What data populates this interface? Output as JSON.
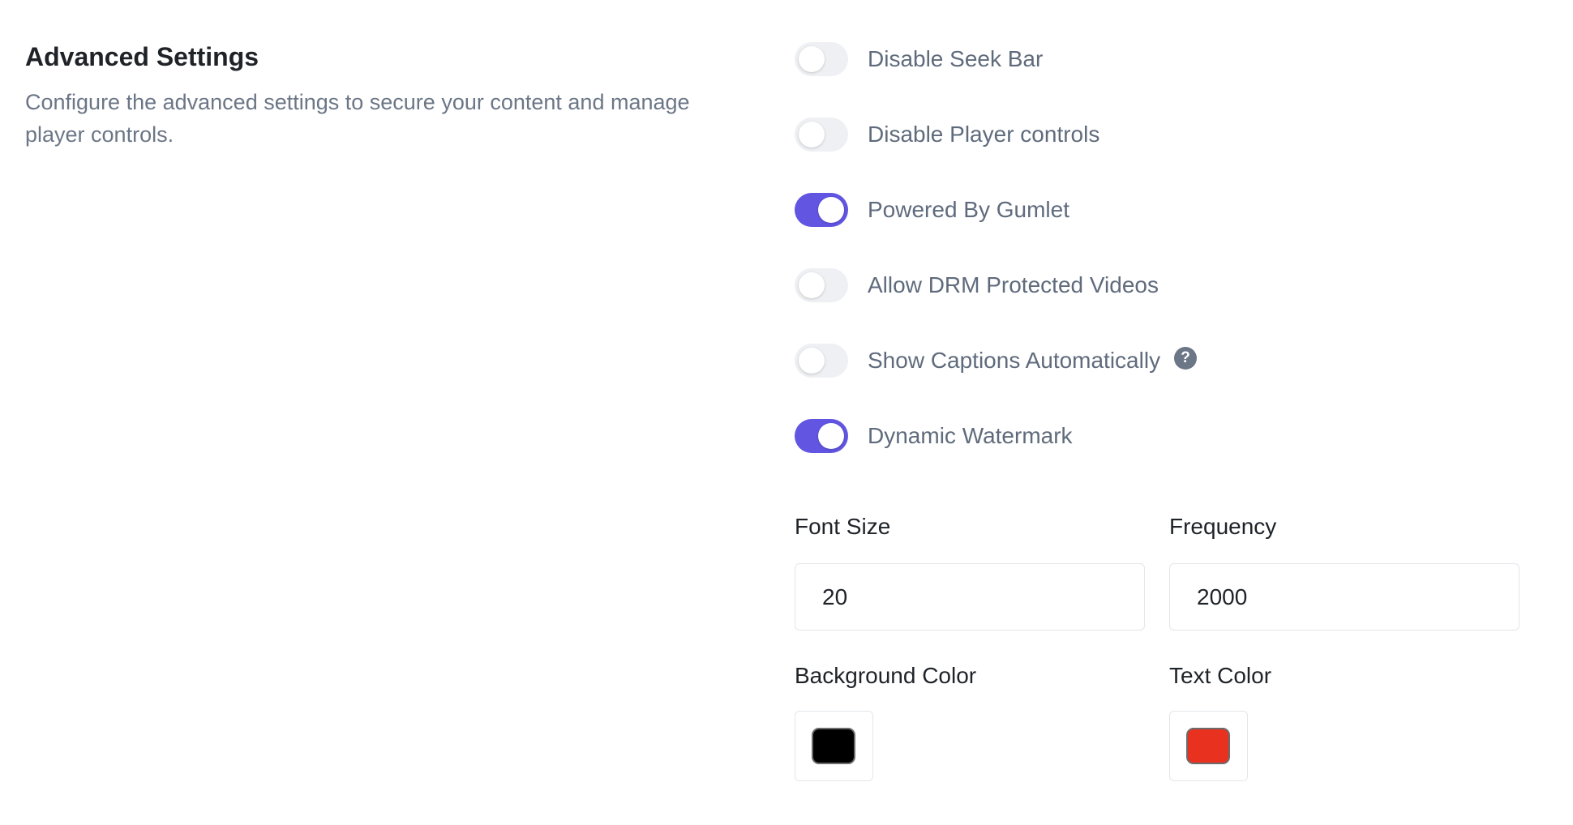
{
  "section": {
    "title": "Advanced Settings",
    "description": "Configure the advanced settings to secure your content and manage player controls."
  },
  "toggles": [
    {
      "label": "Disable Seek Bar",
      "enabled": false
    },
    {
      "label": "Disable Player controls",
      "enabled": false
    },
    {
      "label": "Powered By Gumlet",
      "enabled": true
    },
    {
      "label": "Allow DRM Protected Videos",
      "enabled": false
    },
    {
      "label": "Show Captions Automatically",
      "enabled": false,
      "help_icon": "question-circle-icon",
      "help_glyph": "?"
    },
    {
      "label": "Dynamic Watermark",
      "enabled": true
    }
  ],
  "watermark": {
    "font_size_label": "Font Size",
    "font_size_value": "20",
    "frequency_label": "Frequency",
    "frequency_value": "2000",
    "background_color_label": "Background Color",
    "background_color": "#000000",
    "text_color_label": "Text Color",
    "text_color": "#e8321f"
  },
  "colors": {
    "accent": "#6155e2",
    "toggle_off": "#eef0f3"
  }
}
